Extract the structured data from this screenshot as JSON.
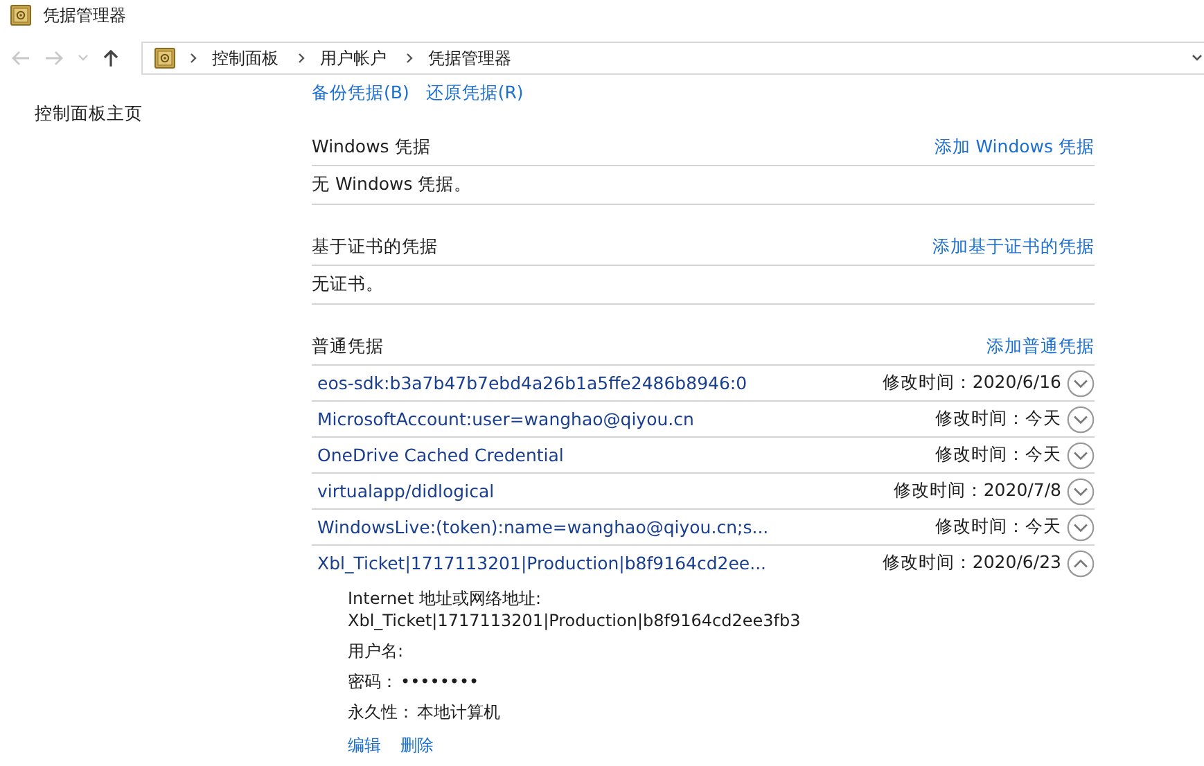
{
  "window": {
    "title": "凭据管理器"
  },
  "breadcrumb": [
    "控制面板",
    "用户帐户",
    "凭据管理器"
  ],
  "sidebar": {
    "items": [
      "控制面板主页"
    ]
  },
  "actions": [
    "备份凭据(B)",
    "还原凭据(R)"
  ],
  "sections": [
    {
      "title": "Windows 凭据",
      "add_link": "添加 Windows 凭据",
      "empty_text": "无 Windows 凭据。"
    },
    {
      "title": "基于证书的凭据",
      "add_link": "添加基于证书的凭据",
      "empty_text": "无证书。"
    },
    {
      "title": "普通凭据",
      "add_link": "添加普通凭据",
      "credentials": [
        {
          "name": "eos-sdk:b3a7b47b7ebd4a26b1a5ffe2486b8946:0",
          "modified": "修改时间：2020/6/16",
          "expanded": false
        },
        {
          "name": "MicrosoftAccount:user=wanghao@qiyou.cn",
          "modified": "修改时间：今天",
          "expanded": false
        },
        {
          "name": "OneDrive Cached Credential",
          "modified": "修改时间：今天",
          "expanded": false
        },
        {
          "name": "virtualapp/didlogical",
          "modified": "修改时间：2020/7/8",
          "expanded": false
        },
        {
          "name": "WindowsLive:(token):name=wanghao@qiyou.cn;s...",
          "modified": "修改时间：今天",
          "expanded": false
        },
        {
          "name": "Xbl_Ticket|1717113201|Production|b8f9164cd2ee...",
          "modified": "修改时间：2020/6/23",
          "expanded": true,
          "details": [
            {
              "label": "Internet 地址或网络地址:",
              "value": "Xbl_Ticket|1717113201|Production|b8f9164cd2ee3fb3",
              "kind": "block"
            },
            {
              "label": "用户名:",
              "kind": "inline"
            },
            {
              "label": "密码：",
              "value": "••••••••",
              "kind": "inline"
            },
            {
              "label": "永久性：",
              "value": "本地计算机",
              "kind": "inline"
            }
          ],
          "detail_actions": [
            "编辑",
            "删除"
          ]
        }
      ]
    }
  ]
}
